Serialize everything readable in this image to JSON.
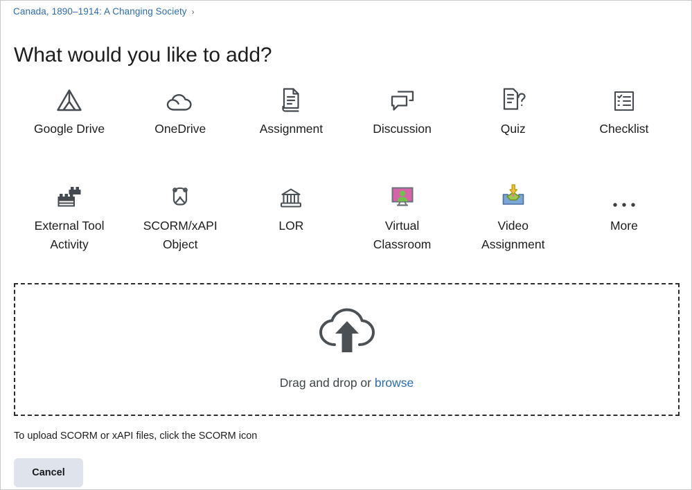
{
  "breadcrumb": {
    "label": "Canada, 1890–1914: A Changing Society",
    "separator": "›"
  },
  "title": "What would you like to add?",
  "grid": {
    "row1": [
      {
        "label": "Google Drive",
        "icon": "google-drive-icon"
      },
      {
        "label": "OneDrive",
        "icon": "onedrive-cloud-icon"
      },
      {
        "label": "Assignment",
        "icon": "document-assignment-icon"
      },
      {
        "label": "Discussion",
        "icon": "speech-bubbles-icon"
      },
      {
        "label": "Quiz",
        "icon": "document-question-icon"
      },
      {
        "label": "Checklist",
        "icon": "checklist-icon"
      }
    ],
    "row2": [
      {
        "label": "External Tool\nActivity",
        "icon": "lego-brick-icon"
      },
      {
        "label": "SCORM/xAPI\nObject",
        "icon": "scorm-object-icon"
      },
      {
        "label": "LOR",
        "icon": "bank-columns-icon"
      },
      {
        "label": "Virtual\nClassroom",
        "icon": "virtual-classroom-monitor-icon"
      },
      {
        "label": "Video\nAssignment",
        "icon": "video-assignment-tray-icon"
      },
      {
        "label": "More",
        "icon": "ellipsis-icon"
      }
    ]
  },
  "dropzone": {
    "icon": "cloud-upload-icon",
    "prompt": "Drag and drop or",
    "browse_label": "browse"
  },
  "helper_text": "To upload SCORM or xAPI files, click the SCORM icon",
  "cancel_label": "Cancel",
  "colors": {
    "link": "#2d6cb5",
    "icon_dark": "#444a4f",
    "dashed_border": "#2b2b2b",
    "button_bg": "#dfe4ec",
    "monitor_pink": "#d763a8",
    "person_green": "#6cc24a",
    "tray_blue": "#7ba7d7",
    "arrow_yellow": "#f2c230",
    "page_border": "#c9c9c9"
  }
}
